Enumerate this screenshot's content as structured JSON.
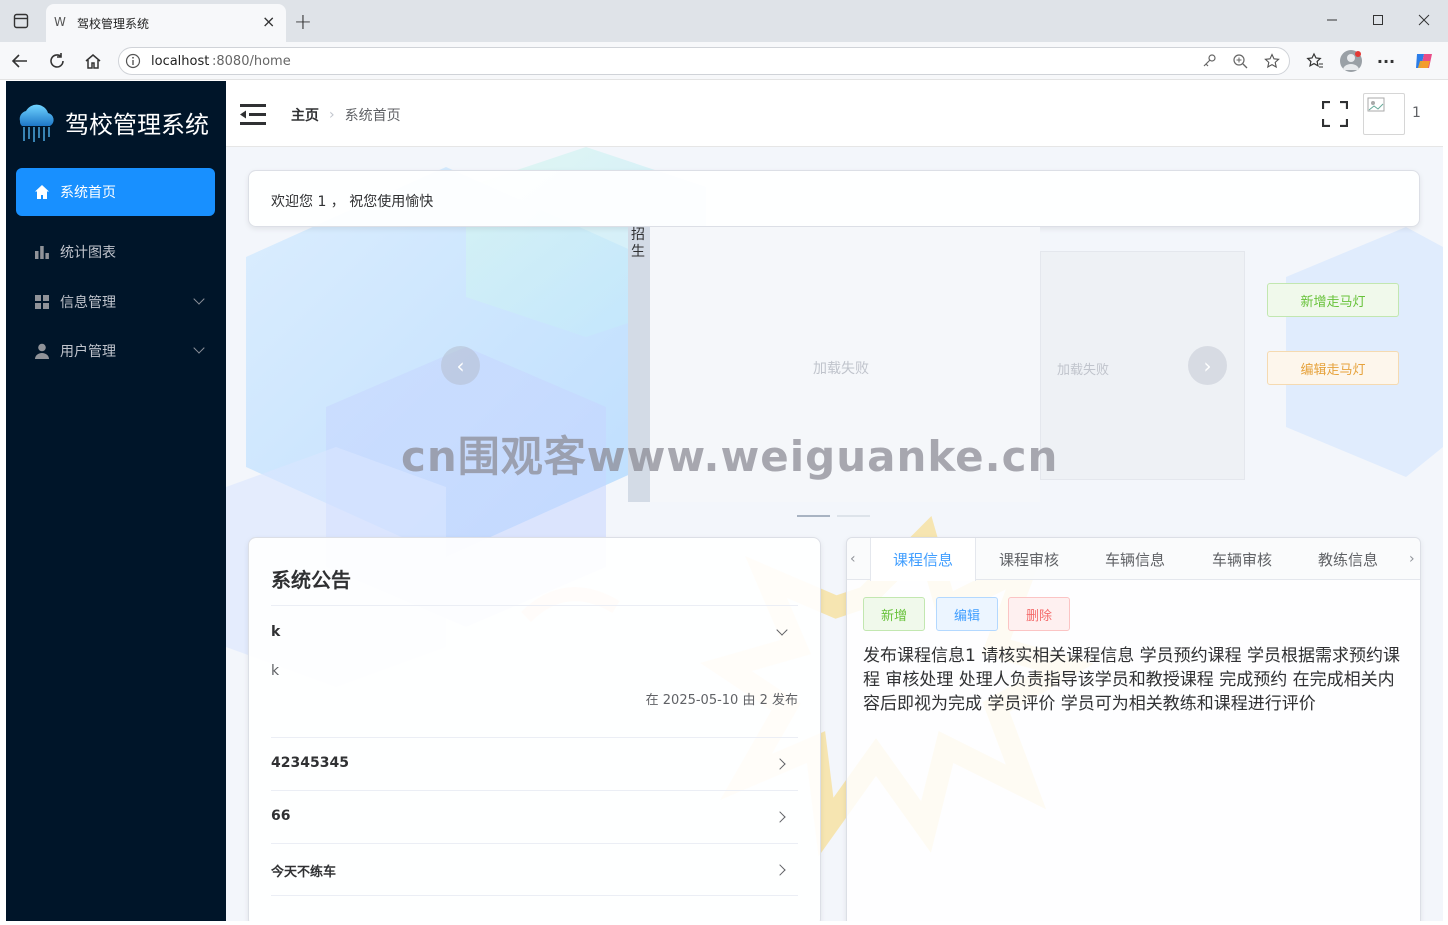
{
  "browser": {
    "tab_title": "驾校管理系统",
    "tab_favicon": "W",
    "url_host": "localhost",
    "url_rest": ":8080/home"
  },
  "sidebar": {
    "app_title": "驾校管理系统",
    "items": [
      {
        "label": "系统首页",
        "icon": "home-icon",
        "active": true
      },
      {
        "label": "统计图表",
        "icon": "bar-chart-icon"
      },
      {
        "label": "信息管理",
        "icon": "grid-icon",
        "expandable": true
      },
      {
        "label": "用户管理",
        "icon": "user-icon",
        "expandable": true
      }
    ]
  },
  "header": {
    "breadcrumb": [
      "主页",
      "系统首页"
    ],
    "username": "1"
  },
  "welcome": {
    "text": "欢迎您 1 ， 祝您使用愉快"
  },
  "carousel": {
    "side_label": "招生",
    "slide_error": "加载失败",
    "slide2_error": "加载失败",
    "add_label": "新增走马灯",
    "edit_label": "编辑走马灯"
  },
  "announcements": {
    "title": "系统公告",
    "items": [
      {
        "title": "k",
        "content": "k",
        "meta": "在 2025-05-10 由 2 发布",
        "expanded": true
      },
      {
        "title": "42345345"
      },
      {
        "title": "66"
      },
      {
        "title": "今天不练车"
      }
    ]
  },
  "info_tabs": {
    "tabs": [
      "课程信息",
      "课程审核",
      "车辆信息",
      "车辆审核",
      "教练信息"
    ],
    "active": 0,
    "buttons": {
      "add": "新增",
      "edit": "编辑",
      "delete": "删除"
    },
    "content": "发布课程信息1 请核实相关课程信息 学员预约课程 学员根据需求预约课程 审核处理 处理人负责指导该学员和教授课程 完成预约 在完成相关内容后即视为完成 学员评价 学员可为相关教练和课程进行评价"
  },
  "watermark": "cn围观客www.weiguanke.cn",
  "colors": {
    "sidebar_bg": "#001529",
    "active_bg": "#1890ff",
    "primary": "#409eff",
    "success": "#67c23a",
    "warning": "#e6a23c",
    "danger": "#f56c6c"
  }
}
